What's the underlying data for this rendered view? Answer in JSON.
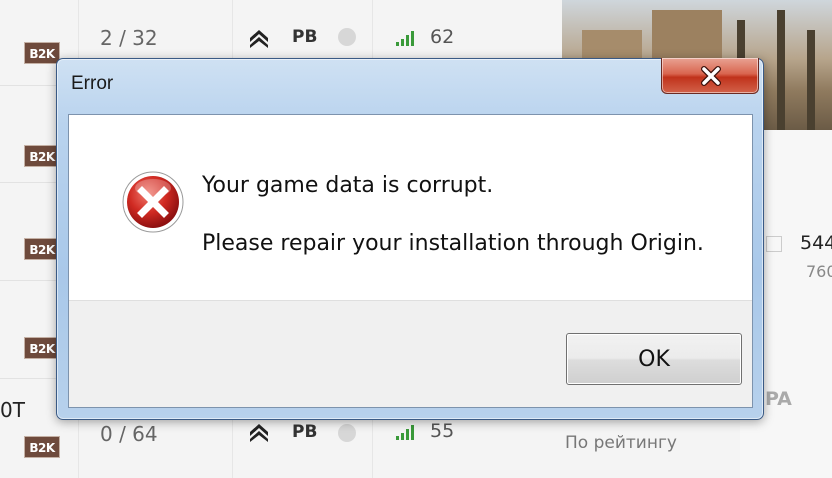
{
  "background": {
    "rows": [
      {
        "tag": "B2K",
        "players": "2 / 32",
        "clan": "PB",
        "ping": "62"
      },
      {
        "tag": "B2K"
      },
      {
        "tag": "B2K"
      },
      {
        "tag": "B2K"
      },
      {
        "tag": "B2K",
        "players": "0 / 64",
        "clan": "PB",
        "ping": "55"
      }
    ],
    "left_truncated": "0T",
    "right_stat_main": "544",
    "right_stat_sub": "760",
    "right_label": "PA",
    "sort_label": "По рейтингу",
    "colors": {
      "badge": "#6e4a3c",
      "ping": "#3a9a3a"
    }
  },
  "dialog": {
    "title": "Error",
    "message_line1": "Your game data is corrupt.",
    "message_line2": "Please repair your installation through Origin.",
    "ok_label": "OK",
    "icons": {
      "close": "close-icon",
      "error": "error-icon"
    },
    "colors": {
      "error_red": "#c8201d",
      "close_red": "#c0321b",
      "frame": "#a9c8e9"
    }
  }
}
